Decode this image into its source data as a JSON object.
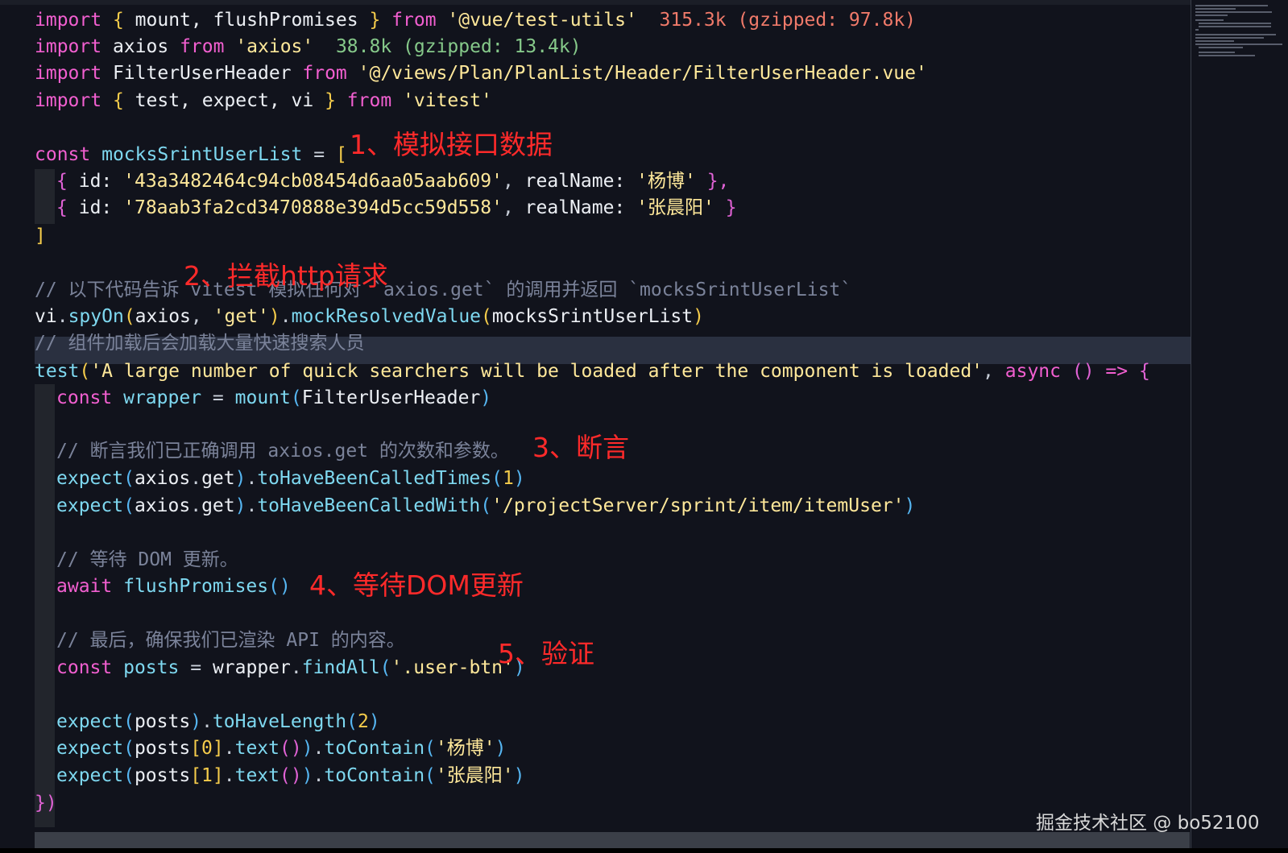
{
  "code": {
    "l1": {
      "kw1": "import",
      "ob": "{",
      "names": " mount, flushPromises ",
      "cb": "}",
      "kw2": "from",
      "src": "'@vue/test-utils'",
      "size": "315.3k (gzipped: 97.8k)"
    },
    "l2": {
      "kw1": "import",
      "name": "axios",
      "kw2": "from",
      "src": "'axios'",
      "size": "38.8k (gzipped: 13.4k)"
    },
    "l3": {
      "kw1": "import",
      "name": "FilterUserHeader",
      "kw2": "from",
      "src": "'@/views/Plan/PlanList/Header/FilterUserHeader.vue'"
    },
    "l4": {
      "kw1": "import",
      "ob": "{",
      "names": " test, expect, vi ",
      "cb": "}",
      "kw2": "from",
      "src": "'vitest'"
    },
    "l5": {
      "kw": "const",
      "name": "mocksSrintUserList",
      "op": "=",
      "ob": "["
    },
    "l6": {
      "ob": "{",
      "k1": "id:",
      "v1": "'43a3482464c94cb08454d6aa05aab609'",
      "k2": "realName:",
      "v2": "'杨博'",
      "cb": "},"
    },
    "l7": {
      "ob": "{",
      "k1": "id:",
      "v1": "'78aab3fa2cd3470888e394d5cc59d558'",
      "k2": "realName:",
      "v2": "'张晨阳'",
      "cb": "}"
    },
    "l8": {
      "cb": "]"
    },
    "l9": {
      "text": "// 以下代码告诉 vitest 模拟任何对 `axios.get` 的调用并返回 `mocksSrintUserList`"
    },
    "l10": {
      "vi": "vi",
      "spy": "spyOn",
      "p1": "(",
      "a1": "axios",
      "a2": "'get'",
      "p2": ")",
      "mrv": "mockResolvedValue",
      "p3": "(",
      "a3": "mocksSrintUserList",
      "p4": ")"
    },
    "l11": {
      "text": "// 组件加载后会加载大量快速搜索人员"
    },
    "l12": {
      "fn": "test",
      "p1": "(",
      "str": "'A large number of quick searchers will be loaded after the component is loaded'",
      "kw": "async",
      "args": "()",
      "arrow": "=>",
      "ob": "{"
    },
    "l13": {
      "kw": "const",
      "name": "wrapper",
      "op": "=",
      "fn": "mount",
      "p1": "(",
      "arg": "FilterUserHeader",
      "p2": ")"
    },
    "l14": {
      "text": "// 断言我们已正确调用 axios.get 的次数和参数。"
    },
    "l15": {
      "fn": "expect",
      "p1": "(",
      "arg": "axios",
      "dot": ".",
      "get": "get",
      "p2": ")",
      "m": "toHaveBeenCalledTimes",
      "p3": "(",
      "num": "1",
      "p4": ")"
    },
    "l16": {
      "fn": "expect",
      "p1": "(",
      "arg": "axios",
      "dot": ".",
      "get": "get",
      "p2": ")",
      "m": "toHaveBeenCalledWith",
      "p3": "(",
      "str": "'/projectServer/sprint/item/itemUser'",
      "p4": ")"
    },
    "l17": {
      "text": "// 等待 DOM 更新。"
    },
    "l18": {
      "kw": "await",
      "fn": "flushPromises",
      "p": "()"
    },
    "l19": {
      "text": "// 最后，确保我们已渲染 API 的内容。"
    },
    "l20": {
      "kw": "const",
      "name": "posts",
      "op": "=",
      "obj": "wrapper",
      "m": "findAll",
      "p1": "(",
      "str": "'.user-btn'",
      "p2": ")"
    },
    "l21": {
      "fn": "expect",
      "p1": "(",
      "arg": "posts",
      "p2": ")",
      "m": "toHaveLength",
      "p3": "(",
      "num": "2",
      "p4": ")"
    },
    "l22": {
      "fn": "expect",
      "p1": "(",
      "arg": "posts",
      "idx": "[0]",
      "m1": "text",
      "pp": "()",
      "p2": ")",
      "m": "toContain",
      "p3": "(",
      "str": "'杨博'",
      "p4": ")"
    },
    "l23": {
      "fn": "expect",
      "p1": "(",
      "arg": "posts",
      "idx": "[1]",
      "m1": "text",
      "pp": "()",
      "p2": ")",
      "m": "toContain",
      "p3": "(",
      "str": "'张晨阳'",
      "p4": ")"
    },
    "l24": {
      "cb": "})"
    }
  },
  "annotations": {
    "a1": "1、模拟接口数据",
    "a2": "2、拦截http请求",
    "a3": "3、断言",
    "a4": "4、等待DOM更新",
    "a5": "5、验证"
  },
  "watermark": "掘金技术社区 @ bo52100",
  "colors": {
    "background": "#11131c",
    "keyword": "#f25fd0",
    "function": "#7ed8f0",
    "string": "#ffe89a",
    "comment": "#7b839a",
    "annotation": "#ff2a2a",
    "current_line": "#2a3040"
  }
}
